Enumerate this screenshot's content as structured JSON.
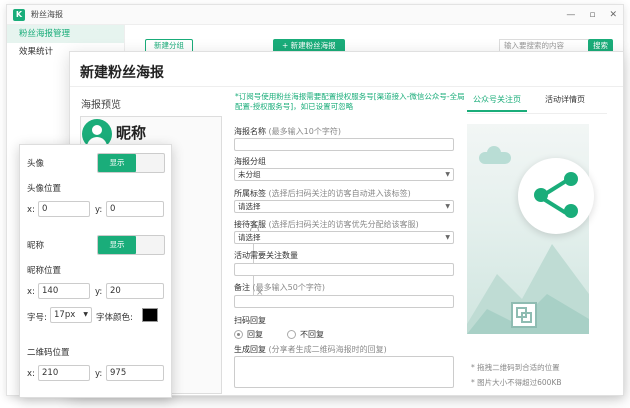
{
  "app": {
    "title": "粉丝海报",
    "logo_letter": "K",
    "controls": [
      "—",
      "▫",
      "✕"
    ]
  },
  "sidebar": {
    "items": [
      {
        "label": "粉丝海报管理",
        "active": true
      },
      {
        "label": "效果统计",
        "active": false
      }
    ]
  },
  "toolbar": {
    "new_group": "新建分组",
    "new_poster": "+ 新建粉丝海报",
    "search_placeholder": "输入要搜索的内容",
    "search_button": "搜索"
  },
  "dialog": {
    "title": "新建粉丝海报",
    "preview_label": "海报预览",
    "nickname_preview": "昵称",
    "canvas_close": "×",
    "notice": "*订阅号使用粉丝海报需要配置授权服务号[渠道接入-微信公众号-全局配置-授权服务号]，如已设置可忽略",
    "fields": {
      "poster_name": {
        "label": "海报名称",
        "hint": "(最多输入10个字符)",
        "value": ""
      },
      "poster_group": {
        "label": "海报分组",
        "value": "未分组"
      },
      "tag": {
        "label": "所属标签",
        "hint": "(选择后扫码关注的访客自动进入该标签)",
        "value": "请选择"
      },
      "agent": {
        "label": "接待客服",
        "hint": "(选择后扫码关注的访客优先分配给该客服)",
        "value": "请选择"
      },
      "follow_count": {
        "label": "活动需要关注数量",
        "value": ""
      },
      "remark": {
        "label": "备注",
        "hint": "(最多输入50个字符)",
        "value": ""
      },
      "scan_reply": {
        "label": "扫码回复",
        "option_on": "回复",
        "option_off": "不回复",
        "selected": "回复"
      },
      "gen_reply": {
        "label": "生成回复",
        "hint": "(分享者生成二维码海报时的回复)",
        "value": ""
      }
    },
    "tabs": [
      {
        "label": "公众号关注页",
        "active": true
      },
      {
        "label": "活动详情页",
        "active": false
      }
    ],
    "tips": [
      "* 拖拽二维码到合适的位置",
      "* 图片大小不得超过600KB"
    ]
  },
  "settings_panel": {
    "avatar_label": "头像",
    "avatar_toggle": "显示",
    "avatar_pos_label": "头像位置",
    "avatar_x": "0",
    "avatar_y": "0",
    "nickname_label": "昵称",
    "nickname_toggle": "显示",
    "nickname_pos_label": "昵称位置",
    "nickname_x": "140",
    "nickname_y": "20",
    "font_size_label": "字号:",
    "font_size_value": "17px",
    "font_color_label": "字体颜色:",
    "font_color": "#000000",
    "qr_pos_label": "二维码位置",
    "qr_x": "210",
    "qr_y": "975",
    "x_label": "x:",
    "y_label": "y:"
  },
  "colors": {
    "accent": "#1aad7a"
  }
}
